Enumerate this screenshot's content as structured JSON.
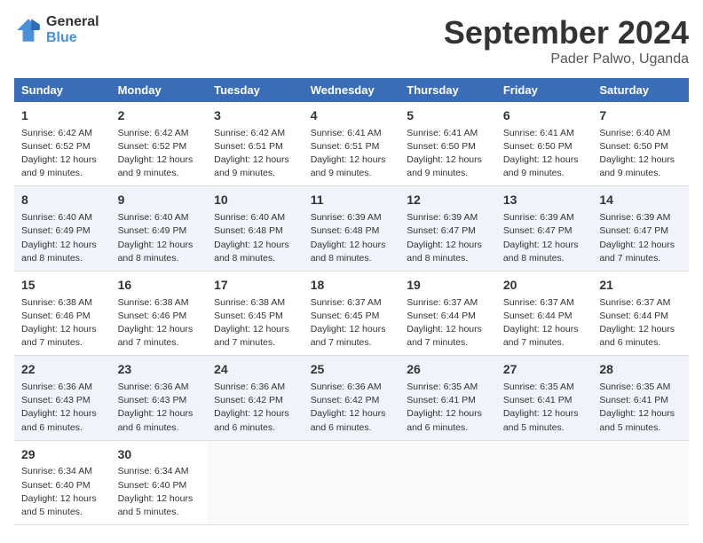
{
  "logo": {
    "general": "General",
    "blue": "Blue"
  },
  "title": "September 2024",
  "subtitle": "Pader Palwo, Uganda",
  "days_of_week": [
    "Sunday",
    "Monday",
    "Tuesday",
    "Wednesday",
    "Thursday",
    "Friday",
    "Saturday"
  ],
  "weeks": [
    [
      {
        "day": "1",
        "sunrise": "6:42 AM",
        "sunset": "6:52 PM",
        "daylight": "12 hours and 9 minutes."
      },
      {
        "day": "2",
        "sunrise": "6:42 AM",
        "sunset": "6:52 PM",
        "daylight": "12 hours and 9 minutes."
      },
      {
        "day": "3",
        "sunrise": "6:42 AM",
        "sunset": "6:51 PM",
        "daylight": "12 hours and 9 minutes."
      },
      {
        "day": "4",
        "sunrise": "6:41 AM",
        "sunset": "6:51 PM",
        "daylight": "12 hours and 9 minutes."
      },
      {
        "day": "5",
        "sunrise": "6:41 AM",
        "sunset": "6:50 PM",
        "daylight": "12 hours and 9 minutes."
      },
      {
        "day": "6",
        "sunrise": "6:41 AM",
        "sunset": "6:50 PM",
        "daylight": "12 hours and 9 minutes."
      },
      {
        "day": "7",
        "sunrise": "6:40 AM",
        "sunset": "6:50 PM",
        "daylight": "12 hours and 9 minutes."
      }
    ],
    [
      {
        "day": "8",
        "sunrise": "6:40 AM",
        "sunset": "6:49 PM",
        "daylight": "12 hours and 8 minutes."
      },
      {
        "day": "9",
        "sunrise": "6:40 AM",
        "sunset": "6:49 PM",
        "daylight": "12 hours and 8 minutes."
      },
      {
        "day": "10",
        "sunrise": "6:40 AM",
        "sunset": "6:48 PM",
        "daylight": "12 hours and 8 minutes."
      },
      {
        "day": "11",
        "sunrise": "6:39 AM",
        "sunset": "6:48 PM",
        "daylight": "12 hours and 8 minutes."
      },
      {
        "day": "12",
        "sunrise": "6:39 AM",
        "sunset": "6:47 PM",
        "daylight": "12 hours and 8 minutes."
      },
      {
        "day": "13",
        "sunrise": "6:39 AM",
        "sunset": "6:47 PM",
        "daylight": "12 hours and 8 minutes."
      },
      {
        "day": "14",
        "sunrise": "6:39 AM",
        "sunset": "6:47 PM",
        "daylight": "12 hours and 7 minutes."
      }
    ],
    [
      {
        "day": "15",
        "sunrise": "6:38 AM",
        "sunset": "6:46 PM",
        "daylight": "12 hours and 7 minutes."
      },
      {
        "day": "16",
        "sunrise": "6:38 AM",
        "sunset": "6:46 PM",
        "daylight": "12 hours and 7 minutes."
      },
      {
        "day": "17",
        "sunrise": "6:38 AM",
        "sunset": "6:45 PM",
        "daylight": "12 hours and 7 minutes."
      },
      {
        "day": "18",
        "sunrise": "6:37 AM",
        "sunset": "6:45 PM",
        "daylight": "12 hours and 7 minutes."
      },
      {
        "day": "19",
        "sunrise": "6:37 AM",
        "sunset": "6:44 PM",
        "daylight": "12 hours and 7 minutes."
      },
      {
        "day": "20",
        "sunrise": "6:37 AM",
        "sunset": "6:44 PM",
        "daylight": "12 hours and 7 minutes."
      },
      {
        "day": "21",
        "sunrise": "6:37 AM",
        "sunset": "6:44 PM",
        "daylight": "12 hours and 6 minutes."
      }
    ],
    [
      {
        "day": "22",
        "sunrise": "6:36 AM",
        "sunset": "6:43 PM",
        "daylight": "12 hours and 6 minutes."
      },
      {
        "day": "23",
        "sunrise": "6:36 AM",
        "sunset": "6:43 PM",
        "daylight": "12 hours and 6 minutes."
      },
      {
        "day": "24",
        "sunrise": "6:36 AM",
        "sunset": "6:42 PM",
        "daylight": "12 hours and 6 minutes."
      },
      {
        "day": "25",
        "sunrise": "6:36 AM",
        "sunset": "6:42 PM",
        "daylight": "12 hours and 6 minutes."
      },
      {
        "day": "26",
        "sunrise": "6:35 AM",
        "sunset": "6:41 PM",
        "daylight": "12 hours and 6 minutes."
      },
      {
        "day": "27",
        "sunrise": "6:35 AM",
        "sunset": "6:41 PM",
        "daylight": "12 hours and 5 minutes."
      },
      {
        "day": "28",
        "sunrise": "6:35 AM",
        "sunset": "6:41 PM",
        "daylight": "12 hours and 5 minutes."
      }
    ],
    [
      {
        "day": "29",
        "sunrise": "6:34 AM",
        "sunset": "6:40 PM",
        "daylight": "12 hours and 5 minutes."
      },
      {
        "day": "30",
        "sunrise": "6:34 AM",
        "sunset": "6:40 PM",
        "daylight": "12 hours and 5 minutes."
      },
      null,
      null,
      null,
      null,
      null
    ]
  ],
  "labels": {
    "sunrise": "Sunrise:",
    "sunset": "Sunset:",
    "daylight": "Daylight:"
  }
}
